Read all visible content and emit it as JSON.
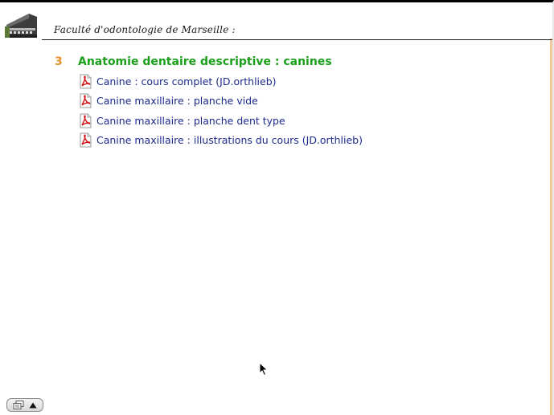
{
  "header": {
    "title": "Faculté d'odontologie de Marseille :",
    "logo_icon": "faculty-building-logo"
  },
  "section": {
    "number": "3",
    "title": "Anatomie dentaire descriptive : canines",
    "number_color": "#e8902a",
    "title_color": "#1aa01a"
  },
  "documents": [
    {
      "label": "Canine : cours complet (JD.orthlieb)",
      "icon": "pdf-icon"
    },
    {
      "label": "Canine maxillaire : planche vide",
      "icon": "pdf-icon"
    },
    {
      "label": "Canine maxillaire : planche dent type",
      "icon": "pdf-icon"
    },
    {
      "label": "Canine maxillaire : illustrations du cours (JD.orthlieb)",
      "icon": "pdf-icon"
    }
  ],
  "link_color": "#1c2a8c",
  "nav_widget": {
    "icons": [
      "pages-icon",
      "arrow-up-icon"
    ]
  }
}
